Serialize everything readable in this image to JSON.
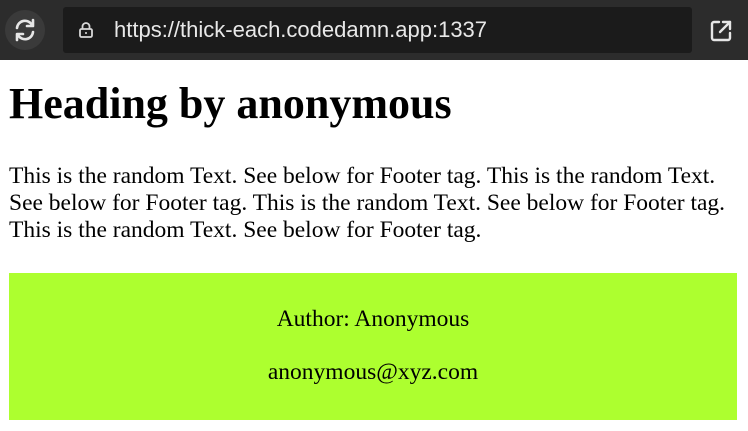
{
  "browser": {
    "url": "https://thick-each.codedamn.app:1337",
    "reload_icon": "reload-icon",
    "lock_icon": "lock-icon",
    "external_icon": "external-link-icon"
  },
  "page": {
    "heading": "Heading by anonymous",
    "paragraph": "This is the random Text. See below for Footer tag. This is the random Text. See below for Footer tag. This is the random Text. See below for Footer tag. This is the random Text. See below for Footer tag.",
    "footer": {
      "author": "Author: Anonymous",
      "email": "anonymous@xyz.com",
      "background": "#adff2f"
    }
  }
}
